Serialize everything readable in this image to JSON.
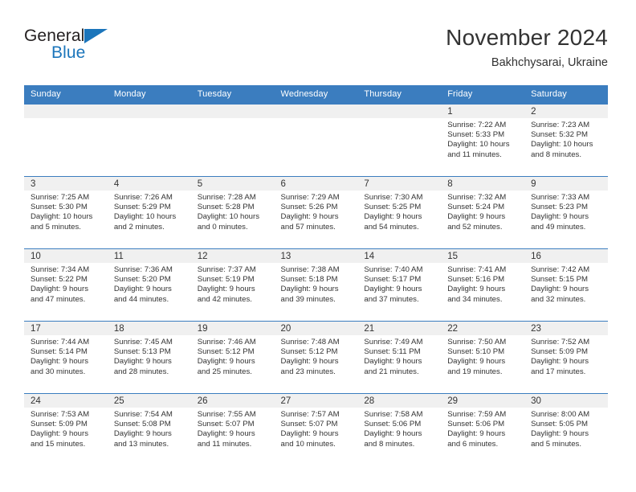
{
  "brand": {
    "word1": "General",
    "word2": "Blue",
    "triangle_color": "#1b75bb"
  },
  "header": {
    "title": "November 2024",
    "subtitle": "Bakhchysarai, Ukraine"
  },
  "theme": {
    "header_blue": "#3b7dbf",
    "daynum_gray": "#f0f0f0",
    "text": "#333333"
  },
  "weekdays": [
    "Sunday",
    "Monday",
    "Tuesday",
    "Wednesday",
    "Thursday",
    "Friday",
    "Saturday"
  ],
  "weeks": [
    [
      {
        "day": "",
        "sunrise": "",
        "sunset": "",
        "daylight1": "",
        "daylight2": "",
        "empty": true
      },
      {
        "day": "",
        "sunrise": "",
        "sunset": "",
        "daylight1": "",
        "daylight2": "",
        "empty": true
      },
      {
        "day": "",
        "sunrise": "",
        "sunset": "",
        "daylight1": "",
        "daylight2": "",
        "empty": true
      },
      {
        "day": "",
        "sunrise": "",
        "sunset": "",
        "daylight1": "",
        "daylight2": "",
        "empty": true
      },
      {
        "day": "",
        "sunrise": "",
        "sunset": "",
        "daylight1": "",
        "daylight2": "",
        "empty": true
      },
      {
        "day": "1",
        "sunrise": "Sunrise: 7:22 AM",
        "sunset": "Sunset: 5:33 PM",
        "daylight1": "Daylight: 10 hours",
        "daylight2": "and 11 minutes.",
        "empty": false
      },
      {
        "day": "2",
        "sunrise": "Sunrise: 7:23 AM",
        "sunset": "Sunset: 5:32 PM",
        "daylight1": "Daylight: 10 hours",
        "daylight2": "and 8 minutes.",
        "empty": false
      }
    ],
    [
      {
        "day": "3",
        "sunrise": "Sunrise: 7:25 AM",
        "sunset": "Sunset: 5:30 PM",
        "daylight1": "Daylight: 10 hours",
        "daylight2": "and 5 minutes.",
        "empty": false
      },
      {
        "day": "4",
        "sunrise": "Sunrise: 7:26 AM",
        "sunset": "Sunset: 5:29 PM",
        "daylight1": "Daylight: 10 hours",
        "daylight2": "and 2 minutes.",
        "empty": false
      },
      {
        "day": "5",
        "sunrise": "Sunrise: 7:28 AM",
        "sunset": "Sunset: 5:28 PM",
        "daylight1": "Daylight: 10 hours",
        "daylight2": "and 0 minutes.",
        "empty": false
      },
      {
        "day": "6",
        "sunrise": "Sunrise: 7:29 AM",
        "sunset": "Sunset: 5:26 PM",
        "daylight1": "Daylight: 9 hours",
        "daylight2": "and 57 minutes.",
        "empty": false
      },
      {
        "day": "7",
        "sunrise": "Sunrise: 7:30 AM",
        "sunset": "Sunset: 5:25 PM",
        "daylight1": "Daylight: 9 hours",
        "daylight2": "and 54 minutes.",
        "empty": false
      },
      {
        "day": "8",
        "sunrise": "Sunrise: 7:32 AM",
        "sunset": "Sunset: 5:24 PM",
        "daylight1": "Daylight: 9 hours",
        "daylight2": "and 52 minutes.",
        "empty": false
      },
      {
        "day": "9",
        "sunrise": "Sunrise: 7:33 AM",
        "sunset": "Sunset: 5:23 PM",
        "daylight1": "Daylight: 9 hours",
        "daylight2": "and 49 minutes.",
        "empty": false
      }
    ],
    [
      {
        "day": "10",
        "sunrise": "Sunrise: 7:34 AM",
        "sunset": "Sunset: 5:22 PM",
        "daylight1": "Daylight: 9 hours",
        "daylight2": "and 47 minutes.",
        "empty": false
      },
      {
        "day": "11",
        "sunrise": "Sunrise: 7:36 AM",
        "sunset": "Sunset: 5:20 PM",
        "daylight1": "Daylight: 9 hours",
        "daylight2": "and 44 minutes.",
        "empty": false
      },
      {
        "day": "12",
        "sunrise": "Sunrise: 7:37 AM",
        "sunset": "Sunset: 5:19 PM",
        "daylight1": "Daylight: 9 hours",
        "daylight2": "and 42 minutes.",
        "empty": false
      },
      {
        "day": "13",
        "sunrise": "Sunrise: 7:38 AM",
        "sunset": "Sunset: 5:18 PM",
        "daylight1": "Daylight: 9 hours",
        "daylight2": "and 39 minutes.",
        "empty": false
      },
      {
        "day": "14",
        "sunrise": "Sunrise: 7:40 AM",
        "sunset": "Sunset: 5:17 PM",
        "daylight1": "Daylight: 9 hours",
        "daylight2": "and 37 minutes.",
        "empty": false
      },
      {
        "day": "15",
        "sunrise": "Sunrise: 7:41 AM",
        "sunset": "Sunset: 5:16 PM",
        "daylight1": "Daylight: 9 hours",
        "daylight2": "and 34 minutes.",
        "empty": false
      },
      {
        "day": "16",
        "sunrise": "Sunrise: 7:42 AM",
        "sunset": "Sunset: 5:15 PM",
        "daylight1": "Daylight: 9 hours",
        "daylight2": "and 32 minutes.",
        "empty": false
      }
    ],
    [
      {
        "day": "17",
        "sunrise": "Sunrise: 7:44 AM",
        "sunset": "Sunset: 5:14 PM",
        "daylight1": "Daylight: 9 hours",
        "daylight2": "and 30 minutes.",
        "empty": false
      },
      {
        "day": "18",
        "sunrise": "Sunrise: 7:45 AM",
        "sunset": "Sunset: 5:13 PM",
        "daylight1": "Daylight: 9 hours",
        "daylight2": "and 28 minutes.",
        "empty": false
      },
      {
        "day": "19",
        "sunrise": "Sunrise: 7:46 AM",
        "sunset": "Sunset: 5:12 PM",
        "daylight1": "Daylight: 9 hours",
        "daylight2": "and 25 minutes.",
        "empty": false
      },
      {
        "day": "20",
        "sunrise": "Sunrise: 7:48 AM",
        "sunset": "Sunset: 5:12 PM",
        "daylight1": "Daylight: 9 hours",
        "daylight2": "and 23 minutes.",
        "empty": false
      },
      {
        "day": "21",
        "sunrise": "Sunrise: 7:49 AM",
        "sunset": "Sunset: 5:11 PM",
        "daylight1": "Daylight: 9 hours",
        "daylight2": "and 21 minutes.",
        "empty": false
      },
      {
        "day": "22",
        "sunrise": "Sunrise: 7:50 AM",
        "sunset": "Sunset: 5:10 PM",
        "daylight1": "Daylight: 9 hours",
        "daylight2": "and 19 minutes.",
        "empty": false
      },
      {
        "day": "23",
        "sunrise": "Sunrise: 7:52 AM",
        "sunset": "Sunset: 5:09 PM",
        "daylight1": "Daylight: 9 hours",
        "daylight2": "and 17 minutes.",
        "empty": false
      }
    ],
    [
      {
        "day": "24",
        "sunrise": "Sunrise: 7:53 AM",
        "sunset": "Sunset: 5:09 PM",
        "daylight1": "Daylight: 9 hours",
        "daylight2": "and 15 minutes.",
        "empty": false
      },
      {
        "day": "25",
        "sunrise": "Sunrise: 7:54 AM",
        "sunset": "Sunset: 5:08 PM",
        "daylight1": "Daylight: 9 hours",
        "daylight2": "and 13 minutes.",
        "empty": false
      },
      {
        "day": "26",
        "sunrise": "Sunrise: 7:55 AM",
        "sunset": "Sunset: 5:07 PM",
        "daylight1": "Daylight: 9 hours",
        "daylight2": "and 11 minutes.",
        "empty": false
      },
      {
        "day": "27",
        "sunrise": "Sunrise: 7:57 AM",
        "sunset": "Sunset: 5:07 PM",
        "daylight1": "Daylight: 9 hours",
        "daylight2": "and 10 minutes.",
        "empty": false
      },
      {
        "day": "28",
        "sunrise": "Sunrise: 7:58 AM",
        "sunset": "Sunset: 5:06 PM",
        "daylight1": "Daylight: 9 hours",
        "daylight2": "and 8 minutes.",
        "empty": false
      },
      {
        "day": "29",
        "sunrise": "Sunrise: 7:59 AM",
        "sunset": "Sunset: 5:06 PM",
        "daylight1": "Daylight: 9 hours",
        "daylight2": "and 6 minutes.",
        "empty": false
      },
      {
        "day": "30",
        "sunrise": "Sunrise: 8:00 AM",
        "sunset": "Sunset: 5:05 PM",
        "daylight1": "Daylight: 9 hours",
        "daylight2": "and 5 minutes.",
        "empty": false
      }
    ]
  ]
}
